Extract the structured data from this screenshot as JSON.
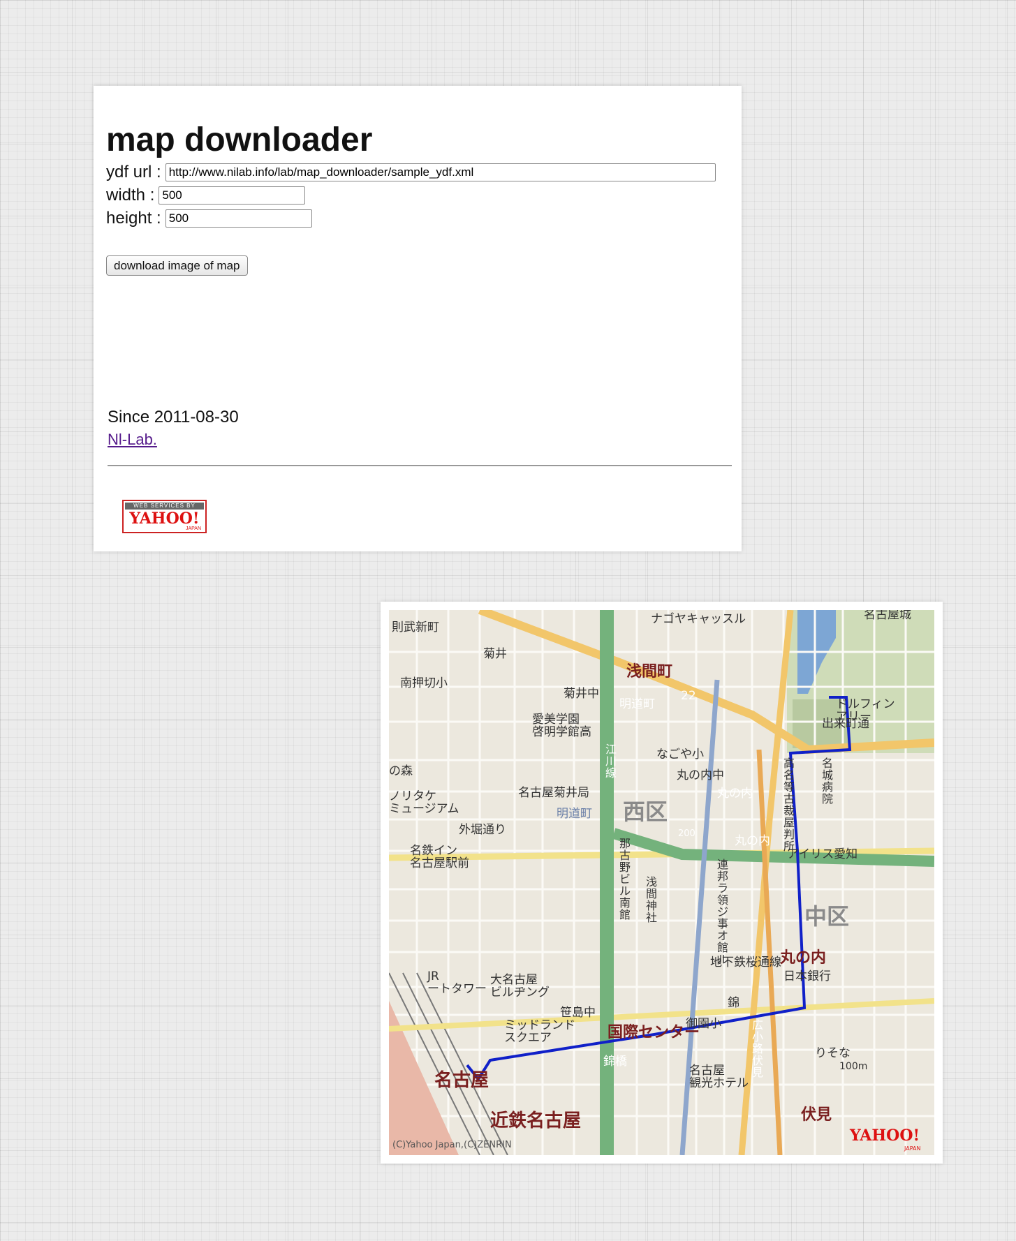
{
  "page": {
    "title": "map downloader",
    "form": {
      "ydf_url_label": "ydf url :",
      "ydf_url_value": "http://www.nilab.info/lab/map_downloader/sample_ydf.xml",
      "width_label": "width :",
      "width_value": "500",
      "height_label": "height :",
      "height_value": "500",
      "submit_label": "download image of map"
    },
    "footer": {
      "since": "Since 2011-08-30",
      "link": "Nl-Lab.",
      "badge_top": "WEB SERVICES BY",
      "badge_brand": "YAHOO!",
      "badge_sub": "JAPAN"
    }
  },
  "map": {
    "stations": [
      "浅間町",
      "国際センター",
      "名古屋",
      "近鉄名古屋",
      "丸の内",
      "伏見"
    ],
    "districts": [
      "西区",
      "中区"
    ],
    "labels": {
      "top_left_area": "則武新町",
      "top_road": "ナゴヤキャッスル",
      "castle": "名古屋城",
      "kikui": "菊井",
      "minami_oshikiri": "南押切小",
      "kikui_chu": "菊井中",
      "aimi_gakuen": "愛美学園\n啓明学館高",
      "meidocho_sign": "明道町",
      "meidocho_sign2": "明道町",
      "route22": "22",
      "route200": "200",
      "horikawa_line": "江\n川\n線",
      "nagoya_sho": "なごや小",
      "marunouchi_chu": "丸の内中",
      "marunouchi_sign": "丸の内",
      "marunouchi_sign2": "丸の内",
      "kikui_post": "名古屋菊井局",
      "sotobori": "外堀通り",
      "noritake": "ノリタケ\nミュージアム",
      "forest": "の森",
      "meitetsu_inn": "名鉄イン\n名古屋駅前",
      "naka_bldg": "那\n古\n野\nビ\nル\n南\n館",
      "asama_jinja": "浅\n間\n神\n社",
      "renpo": "連\n邦\nラ\n領\nジ\n事\nオ\n館\nル",
      "court": "高\n名\n等\n古\n裁\n屋\n判\n所",
      "hospital": "名\n城\n病\n院",
      "dolphin": "ドルフィン\nアリー",
      "demachi": "出来町通",
      "iris": "アイリス愛知",
      "subway_line": "地下鉄桜通線",
      "boj": "日本銀行",
      "dai_nagoya": "大名古屋\nビルヂング",
      "jr_tower": "JR\nートタワー",
      "sasashima": "笹島中",
      "midland": "ミッドランド\nスクエア",
      "nishiki": "錦",
      "misono": "御園小",
      "hirokoji": "広\n小\n路\n伏\n見",
      "resona": "りそな",
      "kanko_hotel": "名古屋\n観光ホテル",
      "nishiki_bashi": "錦橋",
      "scale": "100m",
      "copyright": "(C)Yahoo Japan,(C)ZENRIN",
      "yahoo_logo": "YAHOO!",
      "yahoo_sub": "JAPAN"
    }
  }
}
